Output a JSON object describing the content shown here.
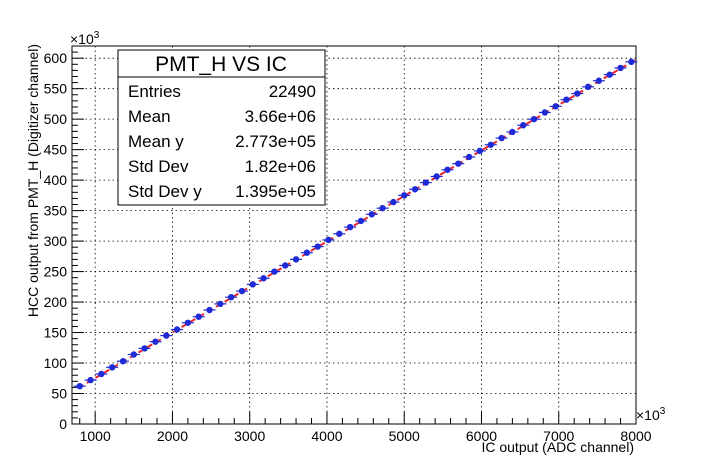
{
  "chart_data": {
    "type": "scatter",
    "title": "",
    "xlabel": "IC output (ADC channel)",
    "ylabel": "HCC output from PMT_H (Digitizer channel)",
    "x_multiplier": "×10",
    "x_multiplier_exp": "3",
    "y_multiplier": "×10",
    "y_multiplier_exp": "3",
    "xlim": [
      700,
      8000
    ],
    "ylim": [
      0,
      620
    ],
    "x_ticks": [
      "1000",
      "2000",
      "3000",
      "4000",
      "5000",
      "6000",
      "7000",
      "8000"
    ],
    "y_ticks": [
      "0",
      "50",
      "100",
      "150",
      "200",
      "250",
      "300",
      "350",
      "400",
      "450",
      "500",
      "550",
      "600"
    ],
    "grid": true,
    "marker_color": "#1f2bd6",
    "fit_line_color": "#e8262b",
    "fit_line": {
      "x": [
        780,
        8000
      ],
      "y": [
        59,
        598
      ]
    },
    "x": [
      800,
      940,
      1080,
      1220,
      1360,
      1500,
      1640,
      1780,
      1920,
      2060,
      2200,
      2340,
      2480,
      2620,
      2760,
      2900,
      3040,
      3180,
      3320,
      3460,
      3600,
      3740,
      3880,
      4020,
      4160,
      4300,
      4440,
      4580,
      4720,
      4860,
      5000,
      5140,
      5280,
      5420,
      5560,
      5700,
      5840,
      5980,
      6120,
      6260,
      6400,
      6540,
      6680,
      6820,
      6960,
      7100,
      7240,
      7380,
      7520,
      7660,
      7800,
      7940
    ],
    "y": [
      62,
      72,
      82,
      93,
      103,
      114,
      124,
      135,
      145,
      155,
      166,
      176,
      187,
      197,
      208,
      218,
      229,
      239,
      250,
      260,
      270,
      281,
      291,
      302,
      312,
      323,
      333,
      344,
      354,
      364,
      375,
      385,
      396,
      406,
      417,
      427,
      438,
      448,
      458,
      469,
      479,
      490,
      500,
      511,
      521,
      532,
      542,
      553,
      563,
      573,
      584,
      594
    ],
    "stats_box": {
      "title": "PMT_H VS IC",
      "rows": [
        {
          "label": "Entries",
          "value": "22490"
        },
        {
          "label": "Mean",
          "value": "3.66e+06"
        },
        {
          "label": "Mean y",
          "value": "2.773e+05"
        },
        {
          "label": "Std Dev",
          "value": "1.82e+06"
        },
        {
          "label": "Std Dev y",
          "value": "1.395e+05"
        }
      ]
    }
  }
}
